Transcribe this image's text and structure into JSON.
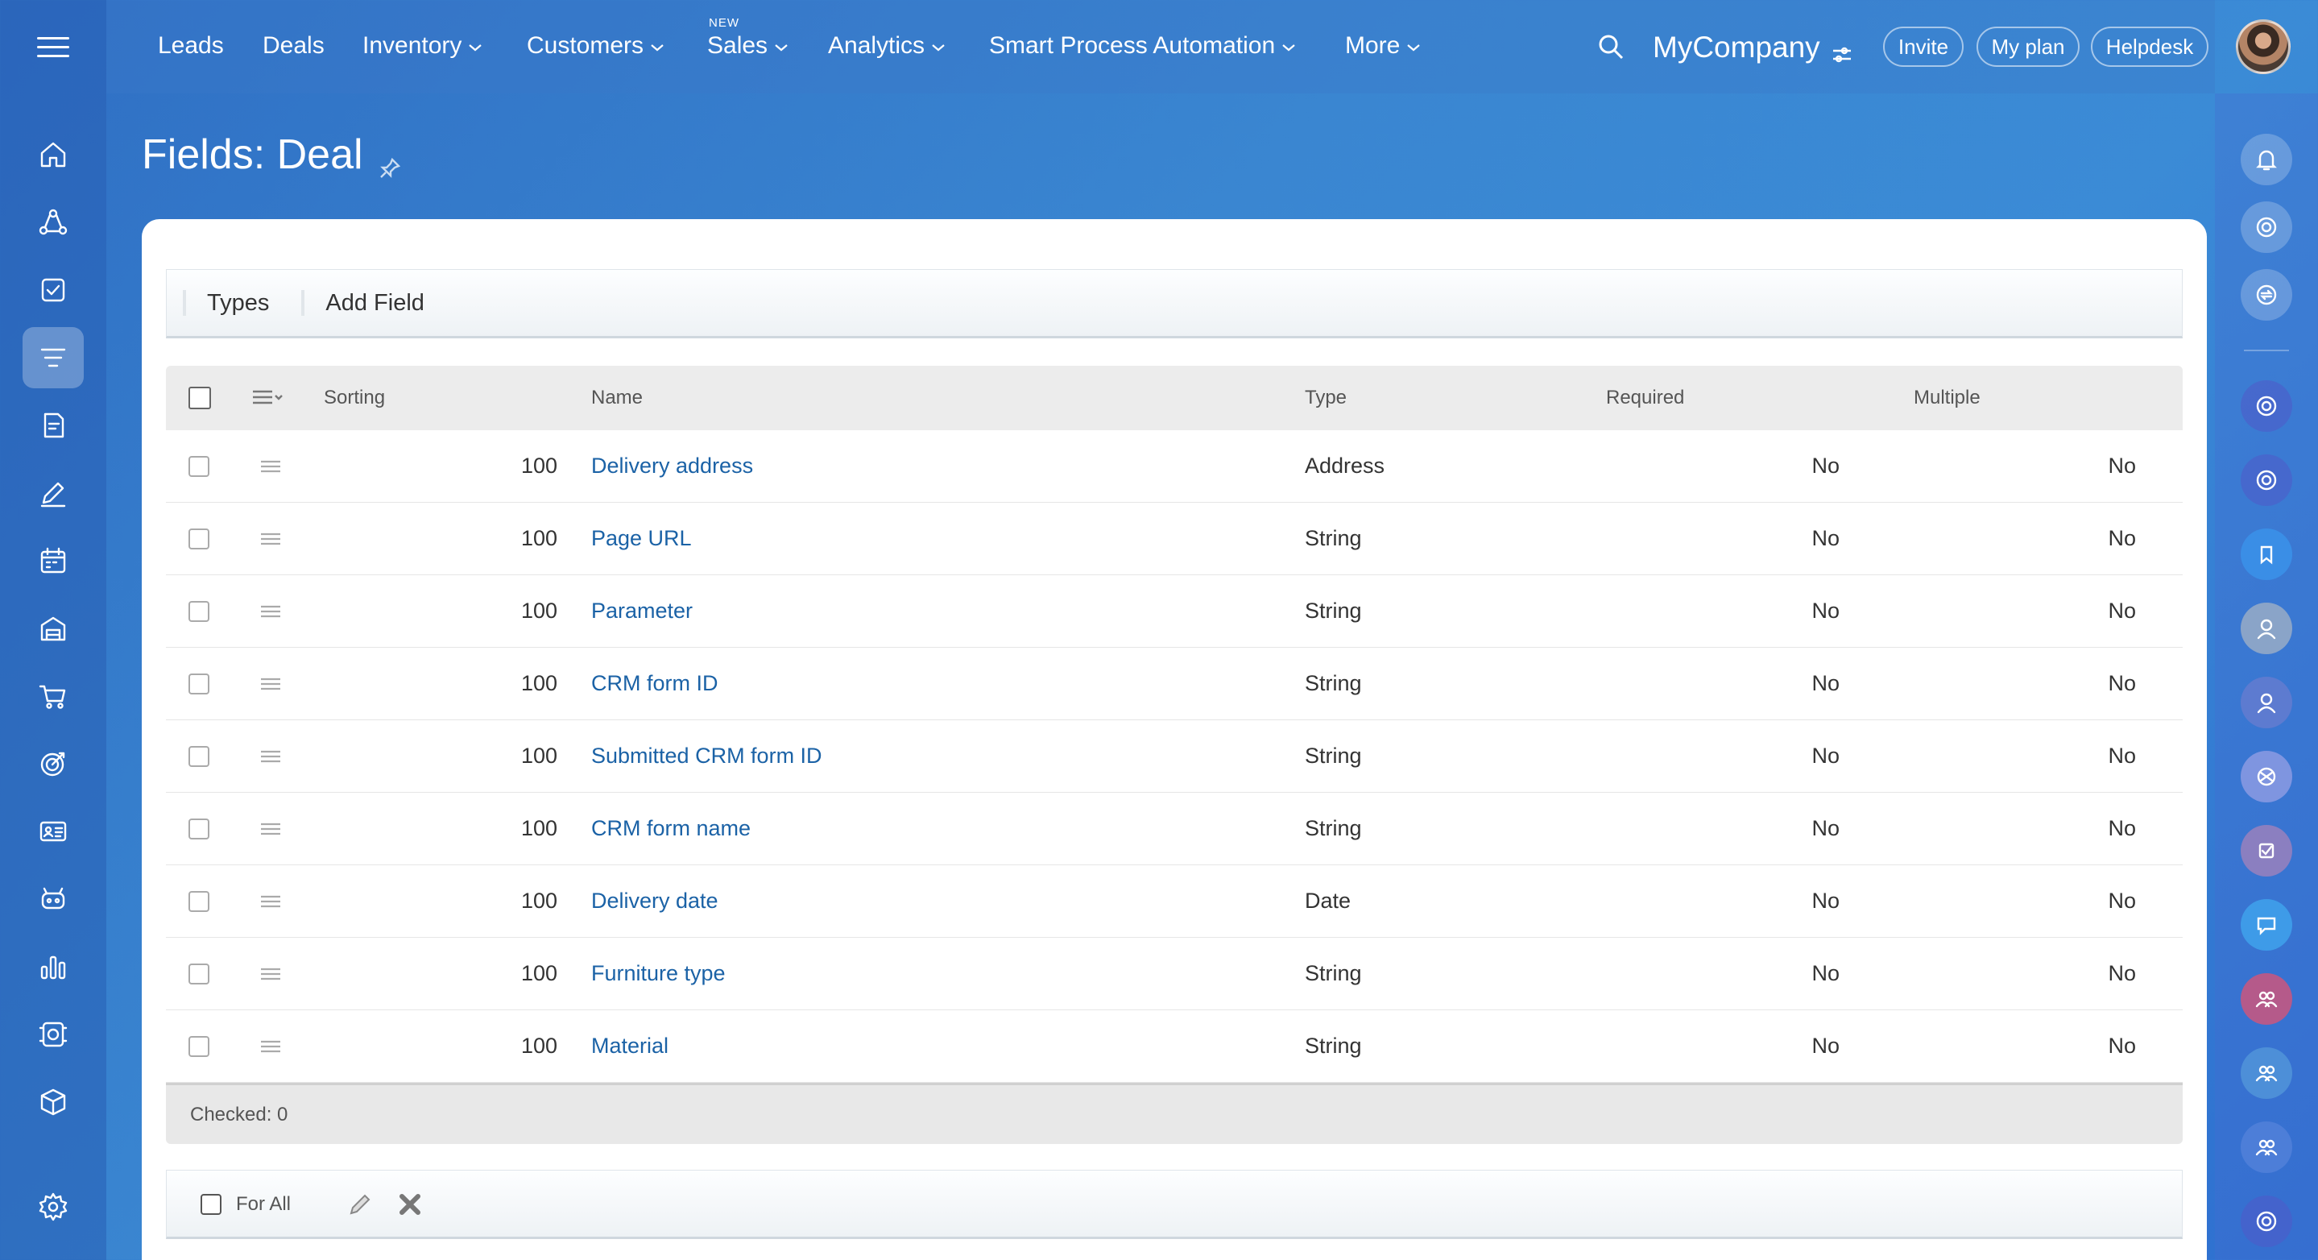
{
  "top_nav": {
    "items": [
      {
        "label": "Leads"
      },
      {
        "label": "Deals"
      },
      {
        "label": "Inventory"
      },
      {
        "label": "Customers"
      },
      {
        "label": "Sales",
        "badge": "NEW"
      },
      {
        "label": "Analytics"
      },
      {
        "label": "Smart Process Automation"
      },
      {
        "label": "More"
      }
    ],
    "company": "MyCompany",
    "invite": "Invite",
    "my_plan": "My plan",
    "helpdesk": "Helpdesk"
  },
  "page": {
    "title": "Fields: Deal"
  },
  "toolbar": {
    "types": "Types",
    "add_field": "Add Field"
  },
  "grid": {
    "columns": {
      "sorting": "Sorting",
      "name": "Name",
      "type": "Type",
      "required": "Required",
      "multiple": "Multiple"
    },
    "rows": [
      {
        "sorting": "100",
        "name": "Delivery address",
        "type": "Address",
        "required": "No",
        "multiple": "No"
      },
      {
        "sorting": "100",
        "name": "Page URL",
        "type": "String",
        "required": "No",
        "multiple": "No"
      },
      {
        "sorting": "100",
        "name": "Parameter",
        "type": "String",
        "required": "No",
        "multiple": "No"
      },
      {
        "sorting": "100",
        "name": "CRM form ID",
        "type": "String",
        "required": "No",
        "multiple": "No"
      },
      {
        "sorting": "100",
        "name": "Submitted CRM form ID",
        "type": "String",
        "required": "No",
        "multiple": "No"
      },
      {
        "sorting": "100",
        "name": "CRM form name",
        "type": "String",
        "required": "No",
        "multiple": "No"
      },
      {
        "sorting": "100",
        "name": "Delivery date",
        "type": "Date",
        "required": "No",
        "multiple": "No"
      },
      {
        "sorting": "100",
        "name": "Furniture type",
        "type": "String",
        "required": "No",
        "multiple": "No"
      },
      {
        "sorting": "100",
        "name": "Material",
        "type": "String",
        "required": "No",
        "multiple": "No"
      }
    ],
    "footer": "Checked: 0"
  },
  "action_bar": {
    "for_all": "For All"
  },
  "colors": {
    "link": "#1b62a6",
    "header_bg": "#ececec"
  }
}
